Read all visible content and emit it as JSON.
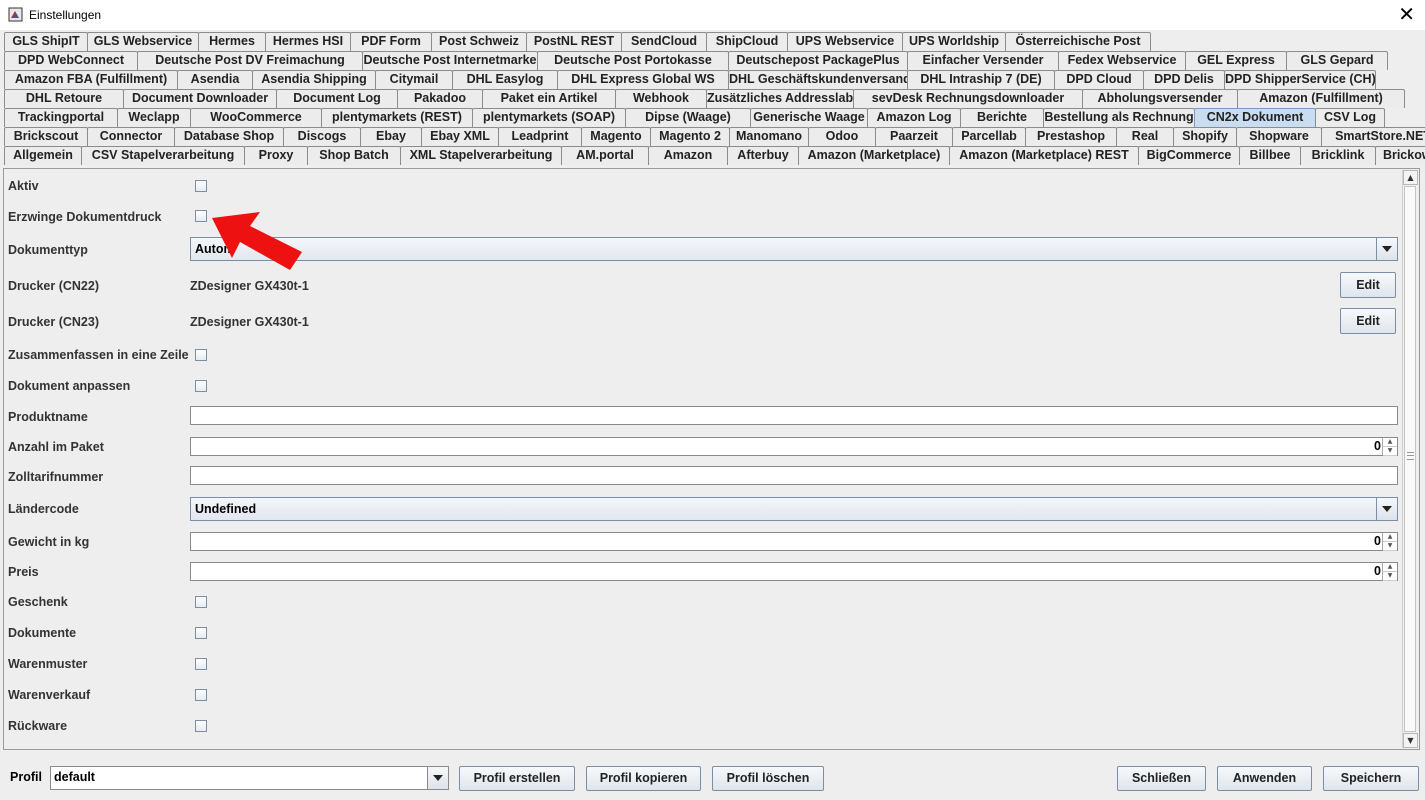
{
  "window": {
    "title": "Einstellungen",
    "close_glyph": "✕"
  },
  "tab_rows": [
    [
      "GLS ShipIT",
      "GLS Webservice",
      "Hermes",
      "Hermes HSI",
      "PDF Form",
      "Post Schweiz",
      "PostNL REST",
      "SendCloud",
      "ShipCloud",
      "UPS Webservice",
      "UPS Worldship",
      "Österreichische Post"
    ],
    [
      "DPD WebConnect",
      "Deutsche Post DV Freimachung",
      "Deutsche Post Internetmarke",
      "Deutsche Post Portokasse",
      "Deutschepost PackagePlus",
      "Einfacher Versender",
      "Fedex Webservice",
      "GEL Express",
      "GLS Gepard"
    ],
    [
      "Amazon FBA (Fulfillment)",
      "Asendia",
      "Asendia Shipping",
      "Citymail",
      "DHL Easylog",
      "DHL Express Global WS",
      "DHL Geschäftskundenversand",
      "DHL Intraship 7 (DE)",
      "DPD Cloud",
      "DPD Delis",
      "DPD ShipperService (CH)"
    ],
    [
      "DHL Retoure",
      "Document Downloader",
      "Document Log",
      "Pakadoo",
      "Paket ein Artikel",
      "Webhook",
      "Zusätzliches Addresslabel",
      "sevDesk Rechnungsdownloader",
      "Abholungsversender",
      "Amazon (Fulfillment)"
    ],
    [
      "Trackingportal",
      "Weclapp",
      "WooCommerce",
      "plentymarkets (REST)",
      "plentymarkets (SOAP)",
      "Dipse (Waage)",
      "Generische Waage",
      "Amazon Log",
      "Berichte",
      "Bestellung als Rechnung",
      "CN2x Dokument",
      "CSV Log"
    ],
    [
      "Brickscout",
      "Connector",
      "Database Shop",
      "Discogs",
      "Ebay",
      "Ebay XML",
      "Leadprint",
      "Magento",
      "Magento 2",
      "Manomano",
      "Odoo",
      "Paarzeit",
      "Parcellab",
      "Prestashop",
      "Real",
      "Shopify",
      "Shopware",
      "SmartStore.NET"
    ],
    [
      "Allgemein",
      "CSV Stapelverarbeitung",
      "Proxy",
      "Shop Batch",
      "XML Stapelverarbeitung",
      "AM.portal",
      "Amazon",
      "Afterbuy",
      "Amazon (Marketplace)",
      "Amazon (Marketplace) REST",
      "BigCommerce",
      "Billbee",
      "Bricklink",
      "Brickowl"
    ]
  ],
  "selected_tab": "CN2x Dokument",
  "form": {
    "aktiv": "Aktiv",
    "erzwinge": "Erzwinge Dokumentdruck",
    "dokumenttyp_label": "Dokumenttyp",
    "dokumenttyp_value": "Autom",
    "drucker22_label": "Drucker (CN22)",
    "drucker22_value": "ZDesigner GX430t-1",
    "drucker23_label": "Drucker (CN23)",
    "drucker23_value": "ZDesigner GX430t-1",
    "edit_label": "Edit",
    "zusammenfassen": "Zusammenfassen in eine Zeile",
    "anpassen": "Dokument anpassen",
    "produktname": "Produktname",
    "anzahl_label": "Anzahl im Paket",
    "anzahl_value": "0",
    "zolltarif": "Zolltarifnummer",
    "laendercode_label": "Ländercode",
    "laendercode_value": "Undefined",
    "gewicht_label": "Gewicht in kg",
    "gewicht_value": "0",
    "preis_label": "Preis",
    "preis_value": "0",
    "geschenk": "Geschenk",
    "dokumente": "Dokumente",
    "warenmuster": "Warenmuster",
    "warenverkauf": "Warenverkauf",
    "rueckware": "Rückware"
  },
  "bottom": {
    "profil_label": "Profil",
    "profil_value": "default",
    "erstellen": "Profil erstellen",
    "kopieren": "Profil kopieren",
    "loeschen": "Profil löschen",
    "schliessen": "Schließen",
    "anwenden": "Anwenden",
    "speichern": "Speichern"
  },
  "colors": {
    "annotation_arrow": "#ee1111",
    "selected_tab": "#c8dcf2"
  }
}
